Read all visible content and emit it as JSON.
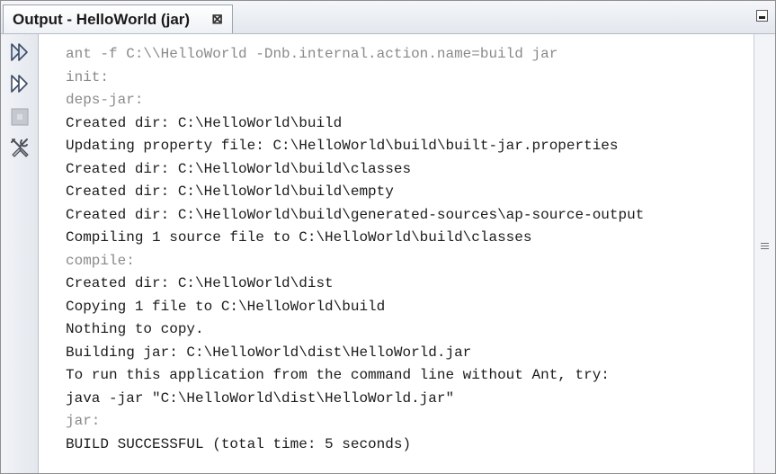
{
  "tab": {
    "title": "Output - HelloWorld (jar)",
    "close_glyph": "⊠"
  },
  "toolbar": {
    "rerun_icon": "double-play-icon",
    "rerun_modified_icon": "double-play-outline-icon",
    "stop_icon": "stop-icon",
    "settings_icon": "tools-icon"
  },
  "output": {
    "lines": [
      {
        "text": "ant -f C:\\\\HelloWorld -Dnb.internal.action.name=build jar",
        "style": "gray"
      },
      {
        "text": "init:",
        "style": "gray"
      },
      {
        "text": "deps-jar:",
        "style": "gray"
      },
      {
        "text": "Created dir: C:\\HelloWorld\\build",
        "style": "norm"
      },
      {
        "text": "Updating property file: C:\\HelloWorld\\build\\built-jar.properties",
        "style": "norm"
      },
      {
        "text": "Created dir: C:\\HelloWorld\\build\\classes",
        "style": "norm"
      },
      {
        "text": "Created dir: C:\\HelloWorld\\build\\empty",
        "style": "norm"
      },
      {
        "text": "Created dir: C:\\HelloWorld\\build\\generated-sources\\ap-source-output",
        "style": "norm"
      },
      {
        "text": "Compiling 1 source file to C:\\HelloWorld\\build\\classes",
        "style": "norm"
      },
      {
        "text": "compile:",
        "style": "gray"
      },
      {
        "text": "Created dir: C:\\HelloWorld\\dist",
        "style": "norm"
      },
      {
        "text": "Copying 1 file to C:\\HelloWorld\\build",
        "style": "norm"
      },
      {
        "text": "Nothing to copy.",
        "style": "norm"
      },
      {
        "text": "Building jar: C:\\HelloWorld\\dist\\HelloWorld.jar",
        "style": "norm"
      },
      {
        "text": "To run this application from the command line without Ant, try:",
        "style": "norm"
      },
      {
        "text": "java -jar \"C:\\HelloWorld\\dist\\HelloWorld.jar\"",
        "style": "norm"
      },
      {
        "text": "jar:",
        "style": "gray"
      },
      {
        "text": "BUILD SUCCESSFUL (total time: 5 seconds)",
        "style": "norm"
      }
    ]
  },
  "colors": {
    "normal_text": "#1b1b1b",
    "gray_text": "#8a8a8a"
  }
}
